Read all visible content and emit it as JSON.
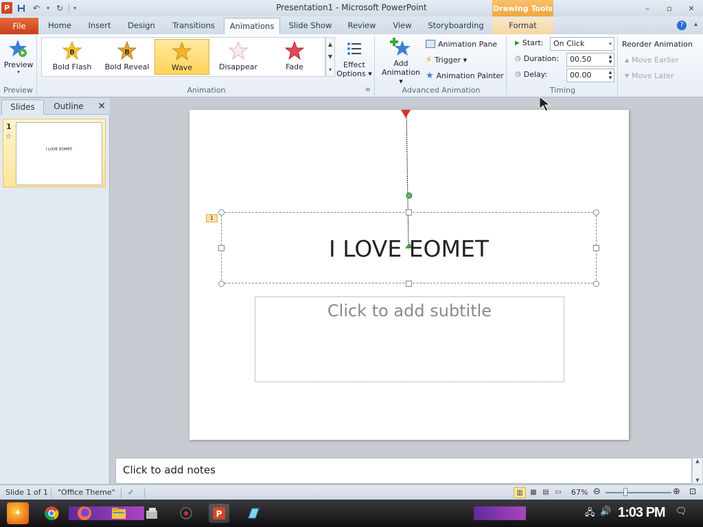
{
  "window": {
    "title": "Presentation1 - Microsoft PowerPoint",
    "app_icon_letter": "P",
    "context_tab_header": "Drawing Tools",
    "minimize_glyph": "–",
    "restore_glyph": "▫",
    "close_glyph": "✕",
    "help_glyph": "?"
  },
  "tabs": [
    {
      "label": "File"
    },
    {
      "label": "Home"
    },
    {
      "label": "Insert"
    },
    {
      "label": "Design"
    },
    {
      "label": "Transitions"
    },
    {
      "label": "Animations"
    },
    {
      "label": "Slide Show"
    },
    {
      "label": "Review"
    },
    {
      "label": "View"
    },
    {
      "label": "Storyboarding"
    },
    {
      "label": "Format"
    }
  ],
  "ribbon": {
    "preview": {
      "label": "Preview",
      "group_label": "Preview"
    },
    "animation_gallery": {
      "group_label": "Animation",
      "items": [
        {
          "label": "Bold Flash"
        },
        {
          "label": "Bold Reveal"
        },
        {
          "label": "Wave"
        },
        {
          "label": "Disappear"
        },
        {
          "label": "Fade"
        }
      ],
      "selected": "Wave"
    },
    "effect_options": {
      "line1": "Effect",
      "line2": "Options ▾"
    },
    "advanced": {
      "group_label": "Advanced Animation",
      "add_line1": "Add",
      "add_line2": "Animation ▾",
      "animation_pane": "Animation Pane",
      "trigger": "Trigger ▾",
      "animation_painter": "Animation Painter"
    },
    "timing": {
      "group_label": "Timing",
      "start_label": "Start:",
      "start_value": "On Click",
      "duration_label": "Duration:",
      "duration_value": "00.50",
      "delay_label": "Delay:",
      "delay_value": "00.00"
    },
    "reorder": {
      "title": "Reorder Animation",
      "move_earlier": "Move Earlier",
      "move_later": "Move Later"
    }
  },
  "left_panel": {
    "tabs": [
      {
        "label": "Slides"
      },
      {
        "label": "Outline"
      }
    ],
    "close_glyph": "✕",
    "thumbnails": [
      {
        "number": "1",
        "text": "I LOVE EOMET"
      }
    ]
  },
  "slide": {
    "title": "I LOVE EOMET",
    "subtitle_placeholder": "Click to add subtitle",
    "animation_badge": "1"
  },
  "notes": {
    "placeholder": "Click to add notes"
  },
  "status_bar": {
    "slide_info": "Slide 1 of 1",
    "theme": "\"Office Theme\"",
    "zoom": "67%"
  },
  "taskbar": {
    "clock": "1:03 PM",
    "apps": [
      "start",
      "chrome",
      "firefox",
      "file-explorer",
      "app",
      "app",
      "powerpoint",
      "app"
    ]
  },
  "colors": {
    "accent": "#d24726",
    "selected": "#ffd35a",
    "ribbon_text": "#2a3a52"
  }
}
